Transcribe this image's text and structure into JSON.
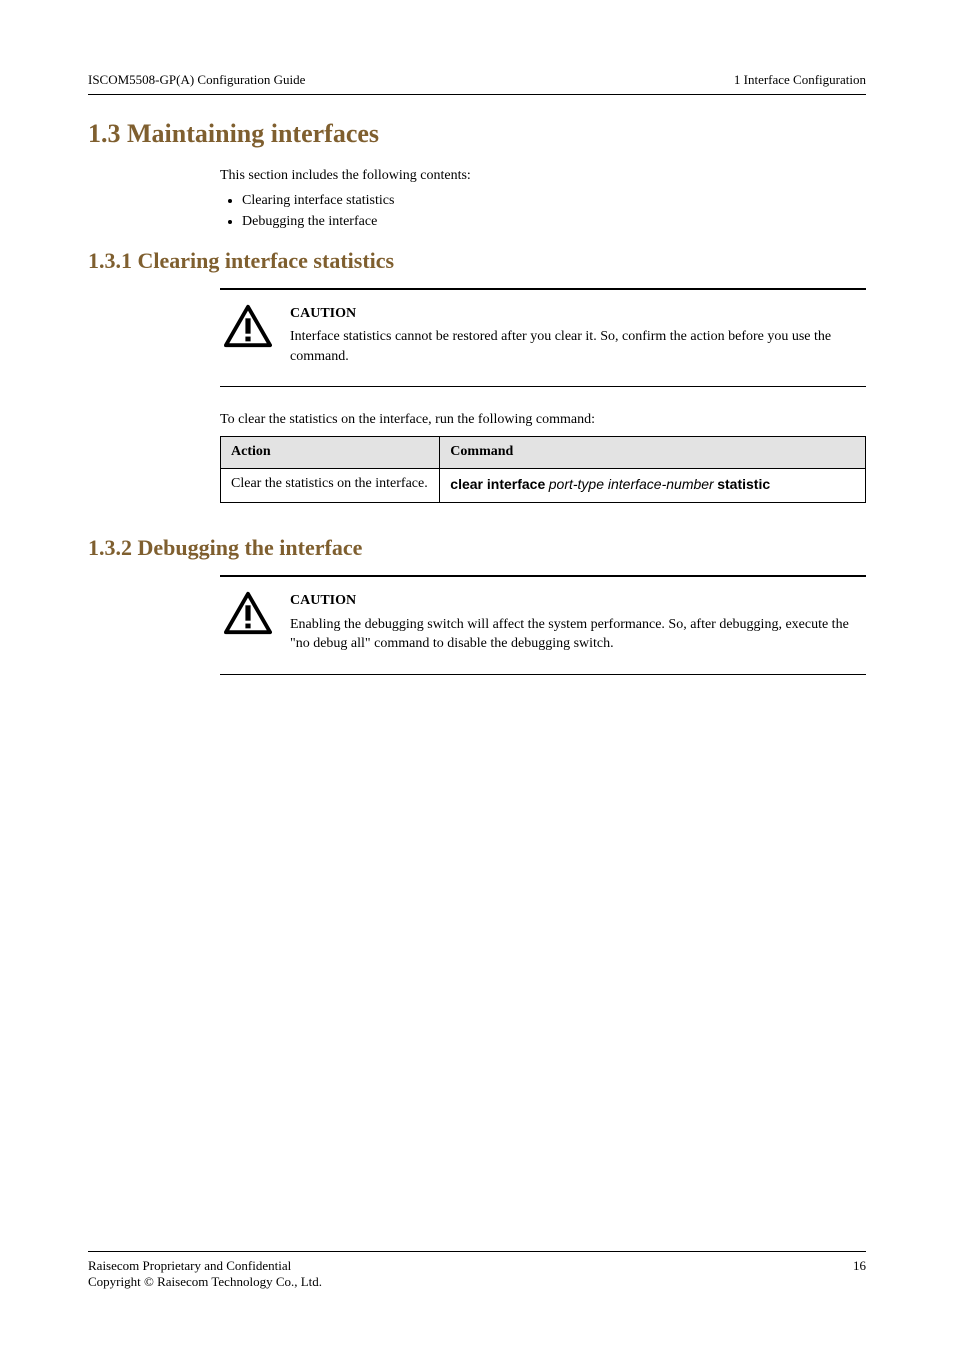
{
  "header": {
    "left": "ISCOM5508-GP(A) Configuration Guide",
    "right": "1 Interface Configuration"
  },
  "section_1_3": {
    "title": "1.3 Maintaining interfaces",
    "intro": "This section includes the following contents:",
    "bullets": [
      "Clearing interface statistics",
      "Debugging the interface"
    ]
  },
  "section_1_3_1": {
    "title": "1.3.1 Clearing interface statistics",
    "caution_title": "CAUTION",
    "caution_body": "Interface statistics cannot be restored after you clear it. So, confirm the action before you use the command.",
    "lead": "To clear the statistics on the interface, run the following command:",
    "table": {
      "col1": "Action",
      "col2": "Command",
      "row_action": "Clear the statistics on the interface.",
      "row_cmd_bold_1": "clear interface",
      "row_cmd_ital": "port-type interface-number",
      "row_cmd_bold_2": "statistic"
    }
  },
  "section_1_3_2": {
    "title": "1.3.2 Debugging the interface",
    "caution_title": "CAUTION",
    "caution_body": "Enabling the debugging switch will affect the system performance. So, after debugging, execute the \"no debug all\" command to disable the debugging switch."
  },
  "footer": {
    "left": "Raisecom Proprietary and Confidential",
    "left2": "Copyright © Raisecom Technology Co., Ltd.",
    "right": "16"
  }
}
